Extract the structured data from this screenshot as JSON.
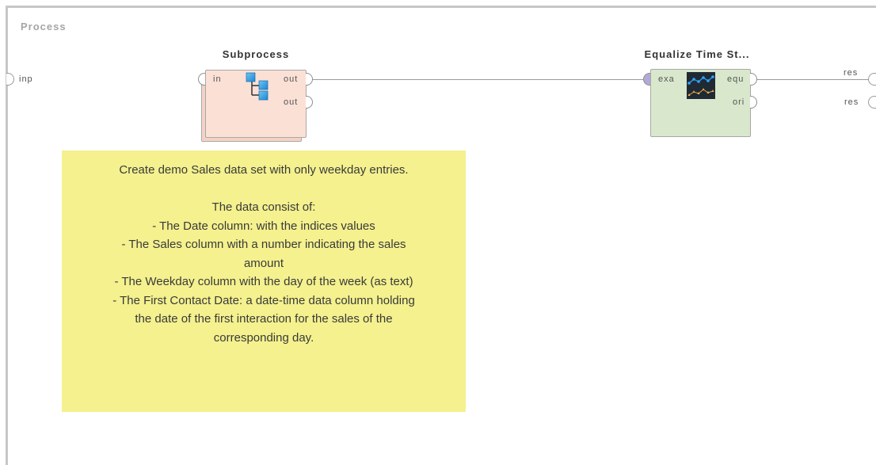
{
  "process": {
    "title": "Process",
    "input_port_label": "inp",
    "result_port_labels": [
      "res",
      "res"
    ]
  },
  "operators": {
    "subprocess": {
      "title": "Subprocess",
      "icon": "subprocess-tree-icon",
      "input_port": "in",
      "output_ports": [
        "out",
        "out"
      ],
      "color": "#fbe0d6"
    },
    "equalize": {
      "title": "Equalize Time St...",
      "icon": "time-series-chart-icon",
      "input_port": "exa",
      "output_ports": [
        "equ",
        "ori"
      ],
      "color": "#d9e8cc"
    }
  },
  "note": {
    "color": "#f4f18e",
    "lines": [
      "Create demo Sales data set with only weekday entries.",
      "",
      "The data consist of:",
      "- The Date column: with the indices values",
      "- The Sales column with a number indicating the sales",
      "amount",
      "- The Weekday column with the day of the week (as text)",
      "- The First Contact Date: a date-time data column holding",
      "the date of the first interaction for the sales of the",
      "corresponding day."
    ]
  }
}
